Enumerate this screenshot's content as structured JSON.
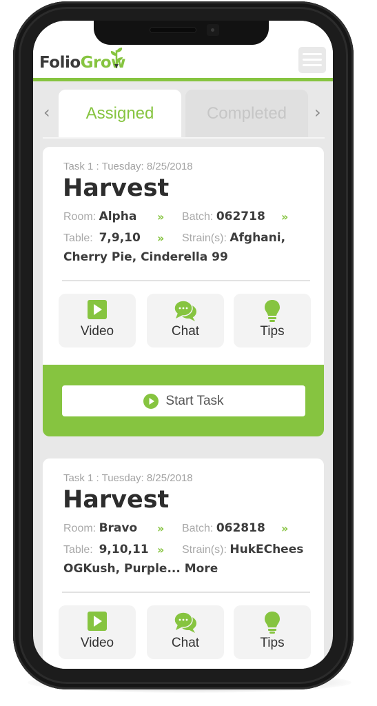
{
  "app": {
    "brand_part1": "Folio",
    "brand_part2": "Grow",
    "accent_color": "#86c440",
    "menu_icon": "hamburger-menu-icon"
  },
  "tabs": {
    "prev_icon": "‹",
    "next_icon": "›",
    "items": [
      {
        "label": "Assigned",
        "active": true
      },
      {
        "label": "Completed",
        "active": false
      }
    ]
  },
  "tasks": [
    {
      "date": "Task 1 : Tuesday: 8/25/2018",
      "title": "Harvest",
      "room_label": "Room:",
      "room": "Alpha",
      "batch_label": "Batch:",
      "batch": "062718",
      "table_label": "Table:",
      "table": "7,9,10",
      "strains_label": "Strain(s):",
      "strains_line1": "Afghani,",
      "strains_line2": "Cherry Pie, Cinderella 99",
      "chevron": "»",
      "actions": [
        {
          "label": "Video",
          "icon": "video-play-icon"
        },
        {
          "label": "Chat",
          "icon": "chat-bubbles-icon"
        },
        {
          "label": "Tips",
          "icon": "lightbulb-icon"
        }
      ],
      "start_label": "Start Task"
    },
    {
      "date": "Task 1 : Tuesday: 8/25/2018",
      "title": "Harvest",
      "room_label": "Room:",
      "room": "Bravo",
      "batch_label": "Batch:",
      "batch": "062818",
      "table_label": "Table:",
      "table": "9,10,11",
      "strains_label": "Strain(s):",
      "strains_line1": "HukEChees",
      "strains_line2": "OGKush, Purple... More",
      "chevron": "»",
      "actions": [
        {
          "label": "Video",
          "icon": "video-play-icon"
        },
        {
          "label": "Chat",
          "icon": "chat-bubbles-icon"
        },
        {
          "label": "Tips",
          "icon": "lightbulb-icon"
        }
      ]
    }
  ]
}
